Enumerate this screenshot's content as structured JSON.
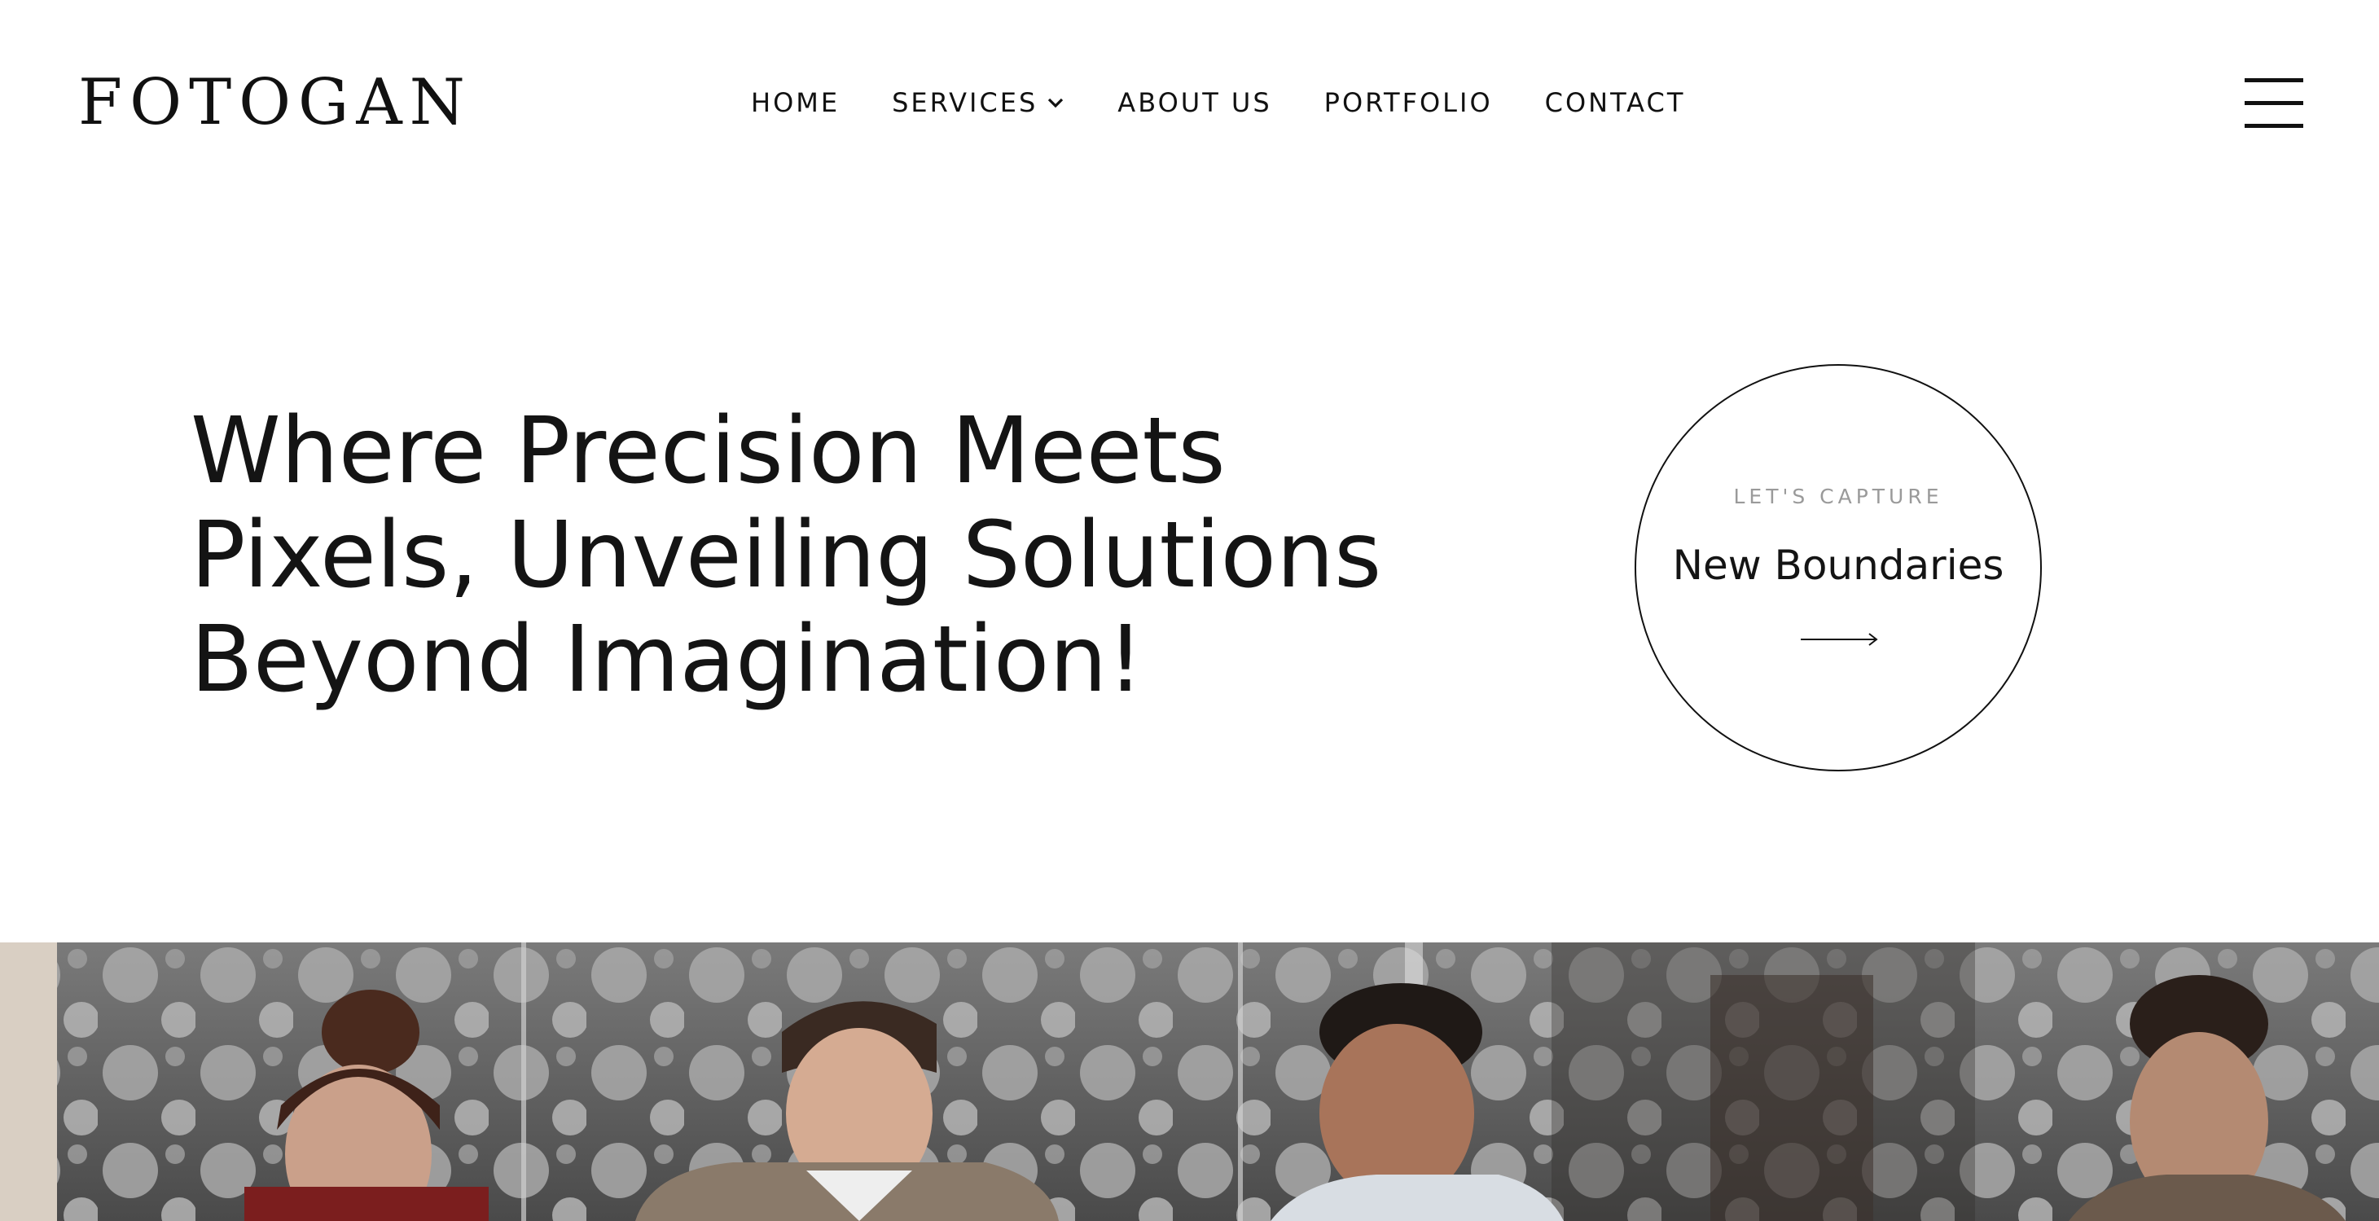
{
  "brand": {
    "logo_text": "FOTOGAN",
    "logo_icon": "camera-lens-icon"
  },
  "nav": {
    "items": [
      {
        "label": "HOME"
      },
      {
        "label": "SERVICES",
        "icon": "chevron-down-icon"
      },
      {
        "label": "ABOUT US"
      },
      {
        "label": "PORTFOLIO"
      },
      {
        "label": "CONTACT"
      }
    ],
    "menu_icon": "hamburger-menu-icon"
  },
  "hero": {
    "title_lines": [
      "Where Precision Meets",
      "Pixels, Unveiling Solutions",
      "Beyond Imagination!"
    ]
  },
  "cta": {
    "kicker": "LET'S CAPTURE",
    "title": "New Boundaries",
    "icon": "arrow-right-icon"
  },
  "photo": {
    "subject": "team of people working in an office"
  },
  "colors": {
    "text": "#141414",
    "muted": "#9a9a9a",
    "background": "#ffffff"
  }
}
